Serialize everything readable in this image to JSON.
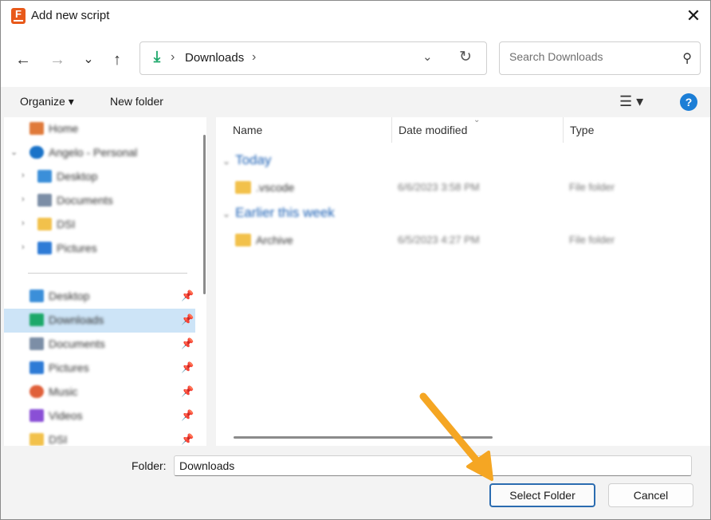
{
  "window": {
    "title": "Add new script",
    "app_icon_letter": "F",
    "close_glyph": "✕"
  },
  "nav": {
    "back_glyph": "←",
    "forward_glyph": "→",
    "recent_glyph": "⌄",
    "up_glyph": "↑",
    "address": {
      "icon": "download-icon",
      "icon_glyph": "⤓",
      "separator": "›",
      "current": "Downloads",
      "dropdown_glyph": "⌄",
      "refresh_glyph": "↻"
    },
    "search": {
      "placeholder": "Search Downloads",
      "icon_glyph": "⚲"
    }
  },
  "toolbar": {
    "organize": "Organize ▾",
    "new_folder": "New folder",
    "view_glyph": "☰ ▾",
    "help_glyph": "?"
  },
  "sidebar": {
    "items": [
      {
        "label": "Home",
        "icon": "home-icon",
        "color": "#e07a3a"
      },
      {
        "label": "Angelo - Personal",
        "icon": "onedrive-icon",
        "color": "#1a73c8"
      },
      {
        "label": "Desktop",
        "icon": "desktop-icon",
        "color": "#3b8fd9"
      },
      {
        "label": "Documents",
        "icon": "documents-icon",
        "color": "#7c8ea6"
      },
      {
        "label": "DSI",
        "icon": "folder-icon",
        "color": "#f2c14b"
      },
      {
        "label": "Pictures",
        "icon": "pictures-icon",
        "color": "#2e7bd6"
      },
      {
        "label": "Desktop",
        "icon": "desktop-icon",
        "color": "#3b8fd9"
      },
      {
        "label": "Downloads",
        "icon": "download-icon",
        "color": "#1ca86a"
      },
      {
        "label": "Documents",
        "icon": "documents-icon",
        "color": "#7c8ea6"
      },
      {
        "label": "Pictures",
        "icon": "pictures-icon",
        "color": "#2e7bd6"
      },
      {
        "label": "Music",
        "icon": "music-icon",
        "color": "#e0603a"
      },
      {
        "label": "Videos",
        "icon": "videos-icon",
        "color": "#8a4fd6"
      },
      {
        "label": "DSI",
        "icon": "folder-icon",
        "color": "#f2c14b"
      }
    ],
    "expander_glyph": "›",
    "expanded_glyph": "⌄",
    "pin_glyph": "📌"
  },
  "files": {
    "columns": [
      "Name",
      "Date modified",
      "Type"
    ],
    "sort_glyph": "⌄",
    "groups": [
      {
        "label": "Today",
        "chevron": "⌄",
        "rows": [
          {
            "name": ".vscode",
            "date": "6/6/2023 3:58 PM",
            "type": "File folder"
          }
        ]
      },
      {
        "label": "Earlier this week",
        "chevron": "⌄",
        "rows": [
          {
            "name": "Archive",
            "date": "6/5/2023 4:27 PM",
            "type": "File folder"
          }
        ]
      }
    ]
  },
  "footer": {
    "folder_label": "Folder:",
    "folder_value": "Downloads",
    "select_button": "Select Folder",
    "cancel_button": "Cancel"
  },
  "colors": {
    "accent": "#2b6cb0",
    "selected_bg": "#cde4f7",
    "arrow": "#f5a623"
  }
}
